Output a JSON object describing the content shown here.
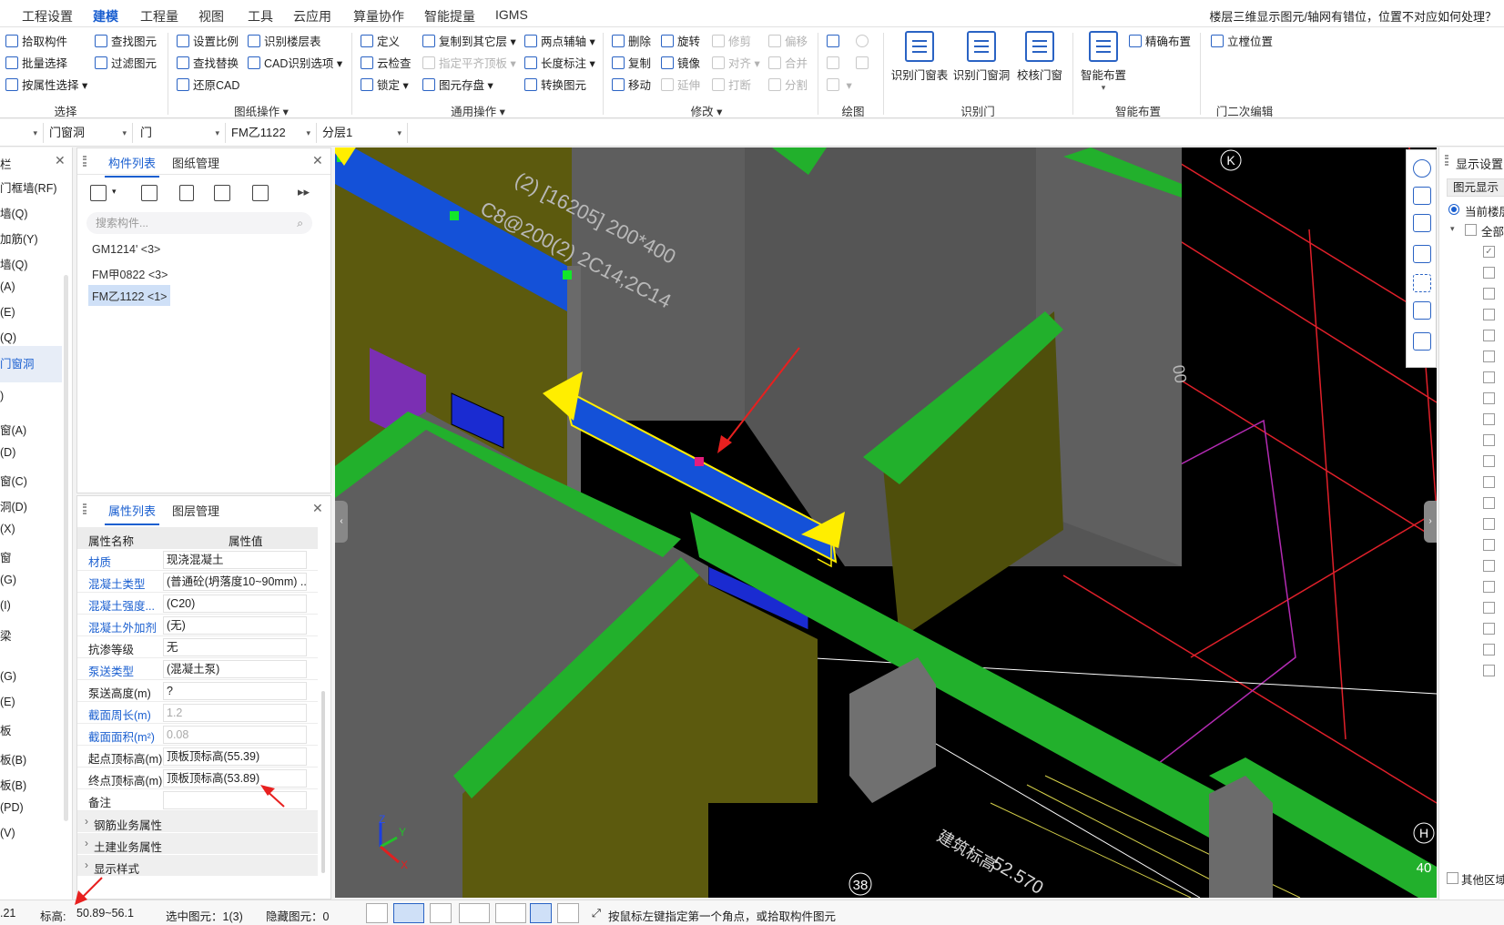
{
  "menu": {
    "items": [
      "工程设置",
      "建模",
      "工程量",
      "视图",
      "工具",
      "云应用",
      "算量协作",
      "智能提量",
      "IGMS"
    ],
    "active": "建模",
    "help_text": "楼层三维显示图元/轴网有错位，位置不对应如何处理？"
  },
  "ribbon": {
    "select_group": {
      "label": "选择",
      "items": [
        "拾取构件",
        "批量选择",
        "按属性选择",
        "查找图元",
        "过滤图元"
      ]
    },
    "drawing_group": {
      "label": "图纸操作",
      "items": [
        "设置比例",
        "查找替换",
        "还原CAD",
        "识别楼层表",
        "CAD识别选项"
      ]
    },
    "general_group": {
      "label": "通用操作",
      "items": [
        "定义",
        "云检查",
        "锁定",
        "复制到其它层",
        "指定平齐顶板",
        "图元存盘",
        "两点辅轴",
        "长度标注",
        "转换图元"
      ]
    },
    "modify_group": {
      "label": "修改",
      "items": [
        "删除",
        "复制",
        "移动",
        "旋转",
        "镜像",
        "延伸",
        "修剪",
        "对齐",
        "打断",
        "偏移",
        "合并",
        "分割"
      ]
    },
    "draw_group": {
      "label": "绘图"
    },
    "recognize_group": {
      "label": "识别门",
      "items": [
        "识别门窗表",
        "识别门窗洞",
        "校核门窗"
      ]
    },
    "smart_group": {
      "label": "智能布置",
      "items": [
        "智能布置",
        "精确布置"
      ]
    },
    "door_edit_group": {
      "label": "门二次编辑",
      "items": [
        "立樘位置"
      ]
    }
  },
  "selectors": [
    "门窗洞",
    "门",
    "FM乙1122",
    "分层1"
  ],
  "left_nav": {
    "items": [
      "栏",
      "门框墙(RF)",
      "墙(Q)",
      "加筋(Y)",
      "墙(Q)",
      "(A)",
      "(E)",
      "(Q)",
      "门窗洞",
      ")",
      "窗(A)",
      "(D)",
      "窗(C)",
      "洞(D)",
      "(X)",
      "窗",
      "(G)",
      "(I)",
      "梁",
      "(G)",
      "(E)",
      "板",
      "板(B)",
      "板(B)",
      "(PD)",
      "(V)"
    ]
  },
  "component_panel": {
    "tabs": [
      "构件列表",
      "图纸管理"
    ],
    "search_placeholder": "搜索构件...",
    "items": [
      "GM1214' <3>",
      "FM甲0822 <3>",
      "FM乙1122 <1>"
    ],
    "selected": "FM乙1122 <1>"
  },
  "property_panel": {
    "tabs": [
      "属性列表",
      "图层管理"
    ],
    "header": {
      "name": "属性名称",
      "value": "属性值"
    },
    "rows": [
      {
        "name": "材质",
        "value": "现浇混凝土",
        "blue": true
      },
      {
        "name": "混凝土类型",
        "value": "(普通砼(坍落度10~90mm) ...",
        "blue": true
      },
      {
        "name": "混凝土强度...",
        "value": "(C20)",
        "blue": true
      },
      {
        "name": "混凝土外加剂",
        "value": "(无)",
        "blue": true
      },
      {
        "name": "抗渗等级",
        "value": "无",
        "blue": false
      },
      {
        "name": "泵送类型",
        "value": "(混凝土泵)",
        "blue": true
      },
      {
        "name": "泵送高度(m)",
        "value": "?",
        "blue": false
      },
      {
        "name": "截面周长(m)",
        "value": "1.2",
        "blue": true,
        "disabled": true
      },
      {
        "name": "截面面积(m²)",
        "value": "0.08",
        "blue": true,
        "disabled": true
      },
      {
        "name": "起点顶标高(m)",
        "value": "顶板顶标高(55.39)",
        "blue": false
      },
      {
        "name": "终点顶标高(m)",
        "value": "顶板顶标高(53.89)",
        "blue": false
      },
      {
        "name": "备注",
        "value": "",
        "blue": false
      }
    ],
    "sections": [
      "钢筋业务属性",
      "土建业务属性",
      "显示样式"
    ]
  },
  "viewport": {
    "annotation_line1": "(2) [16205] 200*400",
    "annotation_line2": "C8@200(2) 2C14;2C14",
    "axis_labels": [
      "K",
      "H",
      "38",
      "40"
    ],
    "elevation_text": "建筑标高",
    "elevation_value": "52.570",
    "partial_label": "00",
    "colors": {
      "wall": "#5e5e5e",
      "wall_side": "#5c5a0e",
      "beam_green": "#22b02c",
      "beam_blue": "#1451d8",
      "select_yellow": "#ffee00",
      "grid_red": "#e0202a"
    }
  },
  "right_panel": {
    "title": "显示设置",
    "tab": "图元显示",
    "radio": "当前楼层",
    "tree_root": "全部",
    "footer": "其他区域"
  },
  "status": {
    "left_partial": ".21",
    "elev_label": "标高:",
    "elev_value": "50.89~56.1",
    "selected": "选中图元：1(3)",
    "hidden": "隐藏图元：0",
    "hint": "按鼠标左键指定第一个角点，或拾取构件图元"
  }
}
